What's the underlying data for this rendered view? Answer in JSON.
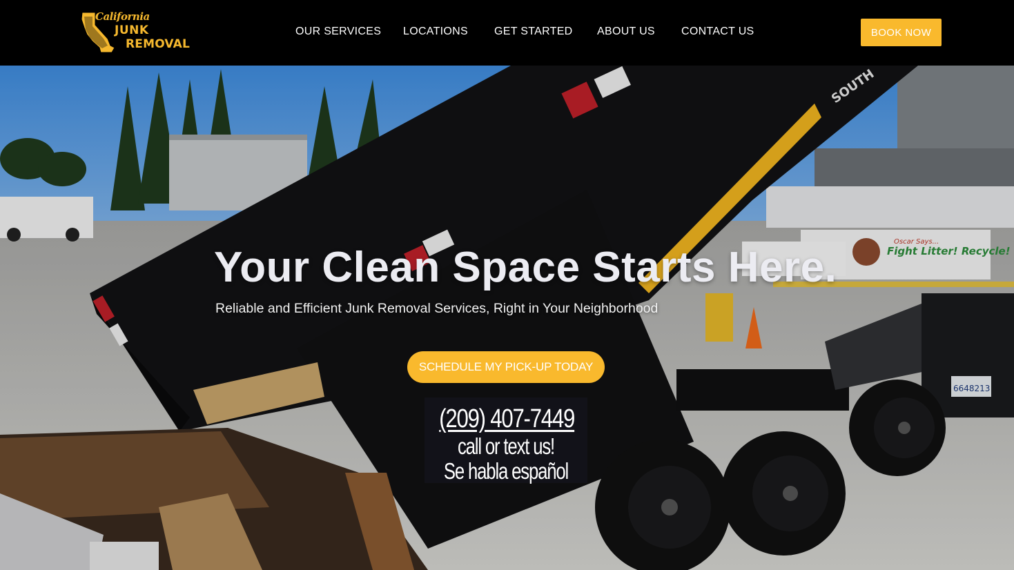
{
  "brand": {
    "logo_script": "California",
    "logo_word1": "JUNK",
    "logo_word2": "REMOVAL",
    "accent_color": "#f9b92d"
  },
  "nav": {
    "items": [
      {
        "label": "OUR SERVICES"
      },
      {
        "label": "LOCATIONS"
      },
      {
        "label": "GET STARTED"
      },
      {
        "label": "ABOUT US"
      },
      {
        "label": "CONTACT US"
      }
    ],
    "book_label": "BOOK NOW"
  },
  "hero": {
    "title": "Your Clean Space Starts Here.",
    "subtitle": "Reliable and Efficient Junk Removal Services, Right in Your Neighborhood",
    "cta_label": "SCHEDULE MY PICK-UP TODAY",
    "phone": "(209) 407-7449",
    "phone_note": "call or text us!",
    "spanish_note": "Se habla español"
  },
  "scene": {
    "trailer_brand": "SOUTH",
    "truck_slogan_top": "Oscar Says...",
    "truck_slogan": "Fight Litter! Recycle!",
    "plate": "6648213"
  }
}
